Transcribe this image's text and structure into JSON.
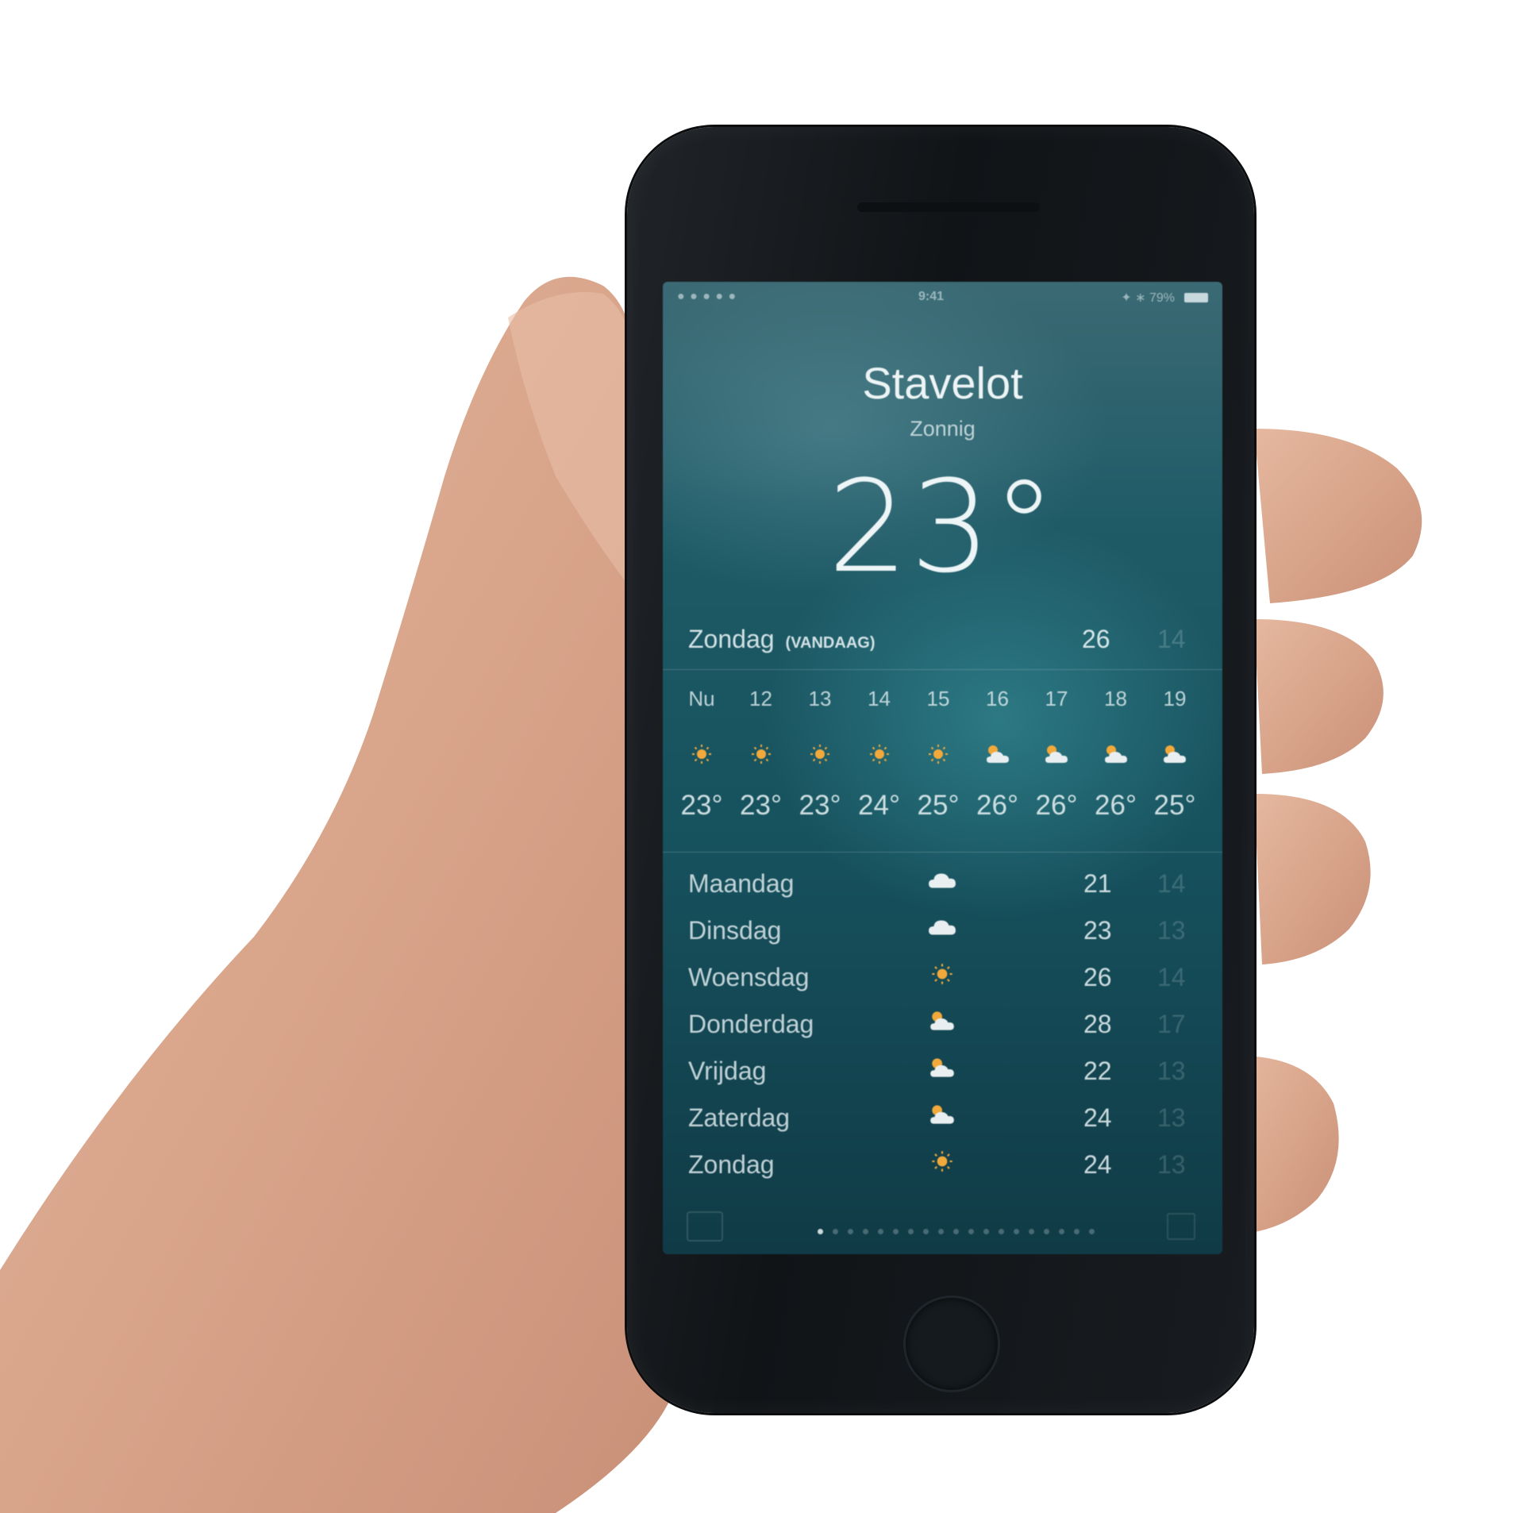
{
  "status_bar": {
    "carrier": "● ● ● ● ●",
    "time": "9:41",
    "right": "✦ ∗ 79%"
  },
  "location": {
    "city": "Stavelot",
    "condition": "Zonnig",
    "temperature": "23°"
  },
  "today": {
    "day": "Zondag",
    "tag": "(VANDAAG)",
    "high": "26",
    "low": "14"
  },
  "hourly": [
    {
      "label": "Nu",
      "icon": "sun-icon",
      "temp": "23°"
    },
    {
      "label": "12",
      "icon": "sun-icon",
      "temp": "23°"
    },
    {
      "label": "13",
      "icon": "sun-icon",
      "temp": "23°"
    },
    {
      "label": "14",
      "icon": "sun-icon",
      "temp": "24°"
    },
    {
      "label": "15",
      "icon": "sun-icon",
      "temp": "25°"
    },
    {
      "label": "16",
      "icon": "partly-cloudy-icon",
      "temp": "26°"
    },
    {
      "label": "17",
      "icon": "partly-cloudy-icon",
      "temp": "26°"
    },
    {
      "label": "18",
      "icon": "partly-cloudy-icon",
      "temp": "26°"
    },
    {
      "label": "19",
      "icon": "partly-cloudy-icon",
      "temp": "25°"
    }
  ],
  "daily": [
    {
      "day": "Maandag",
      "icon": "cloud-icon",
      "high": "21",
      "low": "14"
    },
    {
      "day": "Dinsdag",
      "icon": "cloud-icon",
      "high": "23",
      "low": "13"
    },
    {
      "day": "Woensdag",
      "icon": "sun-icon",
      "high": "26",
      "low": "14"
    },
    {
      "day": "Donderdag",
      "icon": "partly-cloudy-icon",
      "high": "28",
      "low": "17"
    },
    {
      "day": "Vrijdag",
      "icon": "partly-cloudy-icon",
      "high": "22",
      "low": "13"
    },
    {
      "day": "Zaterdag",
      "icon": "partly-cloudy-icon",
      "high": "24",
      "low": "13"
    },
    {
      "day": "Zondag",
      "icon": "sun-icon",
      "high": "24",
      "low": "13"
    }
  ],
  "colors": {
    "sun": "#f2a93b",
    "cloud": "#e9eef0",
    "screen_top": "#3b6a74",
    "screen_bottom": "#103b46"
  }
}
